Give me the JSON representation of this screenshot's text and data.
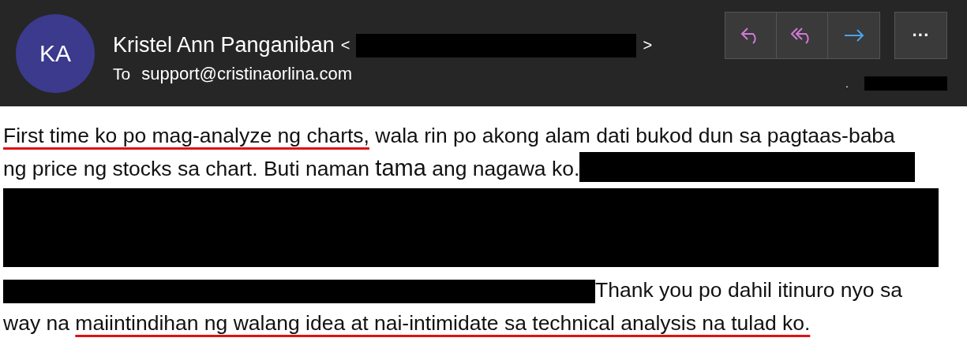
{
  "header": {
    "avatar_initials": "KA",
    "sender_name": "Kristel Ann Panganiban",
    "open_bracket": "<",
    "close_bracket": ">",
    "to_label": "To",
    "recipient": "support@cristinaorlina.com",
    "dot": ".",
    "actions": [
      {
        "kind": "reply"
      },
      {
        "kind": "reply-all"
      },
      {
        "kind": "forward"
      }
    ],
    "more": "···"
  },
  "body": {
    "lines": [
      {
        "parts": [
          {
            "kind": "text",
            "segments": [
              {
                "kind": "underlined",
                "text": "First time ko po mag-analyze ng charts,"
              },
              {
                "kind": "plain",
                "text": " wala rin po akong alam dati bukod dun sa pagtaas-baba"
              }
            ]
          }
        ]
      },
      {
        "parts": [
          {
            "kind": "text",
            "segments": [
              {
                "kind": "plain",
                "text": "ng price ng stocks sa chart. Buti naman "
              },
              {
                "kind": "large",
                "text": "tama"
              },
              {
                "kind": "plain",
                "text": " ang nagawa ko."
              }
            ]
          },
          {
            "kind": "bar"
          }
        ]
      },
      {
        "parts": [
          {
            "kind": "block"
          }
        ]
      },
      {
        "parts": [
          {
            "kind": "bar"
          },
          {
            "kind": "text",
            "segments": [
              {
                "kind": "plain",
                "text": "Thank you po dahil itinuro nyo sa"
              }
            ]
          }
        ]
      },
      {
        "parts": [
          {
            "kind": "text",
            "segments": [
              {
                "kind": "plain",
                "text": "way na "
              },
              {
                "kind": "underlined",
                "text": "maiintindihan ng walang idea at nai-intimidate sa technical analysis na tulad ko."
              }
            ]
          }
        ]
      }
    ]
  }
}
